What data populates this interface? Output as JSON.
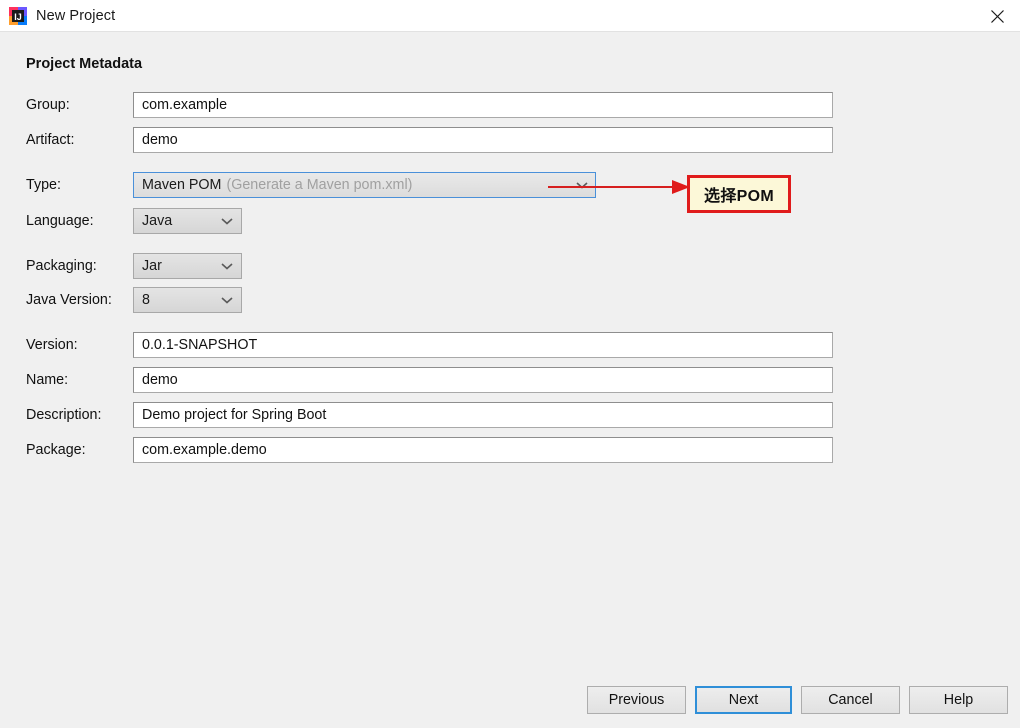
{
  "window": {
    "title": "New Project",
    "app_icon": "intellij-idea-icon",
    "close_icon": "close-icon"
  },
  "section": {
    "heading": "Project Metadata"
  },
  "fields": [
    {
      "label": "Group:",
      "value": "com.example",
      "kind": "text",
      "name": "group"
    },
    {
      "label": "Artifact:",
      "value": "demo",
      "kind": "text",
      "name": "artifact"
    },
    {
      "label": "Type:",
      "value": "Maven POM",
      "hint": "(Generate a Maven pom.xml)",
      "kind": "combo-wide",
      "name": "type"
    },
    {
      "label": "Language:",
      "value": "Java",
      "kind": "combo-small",
      "name": "language"
    },
    {
      "label": "Packaging:",
      "value": "Jar",
      "kind": "combo-small",
      "name": "packaging"
    },
    {
      "label": "Java Version:",
      "value": "8",
      "kind": "combo-small",
      "name": "java-version"
    },
    {
      "label": "Version:",
      "value": "0.0.1-SNAPSHOT",
      "kind": "text",
      "name": "version"
    },
    {
      "label": "Name:",
      "value": "demo",
      "kind": "text",
      "name": "name"
    },
    {
      "label": "Description:",
      "value": "Demo project for Spring Boot",
      "kind": "text",
      "name": "description"
    },
    {
      "label": "Package:",
      "value": "com.example.demo",
      "kind": "text",
      "name": "package"
    }
  ],
  "annotation": {
    "text": "选择POM",
    "border_color": "#e01b1b",
    "fill_color": "#fcf8d8",
    "arrow_color": "#d61f1f"
  },
  "footer": {
    "previous_label": "Previous",
    "next_label": "Next",
    "cancel_label": "Cancel",
    "help_label": "Help",
    "default_button": "Next",
    "focus_color": "#2f8fd8"
  }
}
